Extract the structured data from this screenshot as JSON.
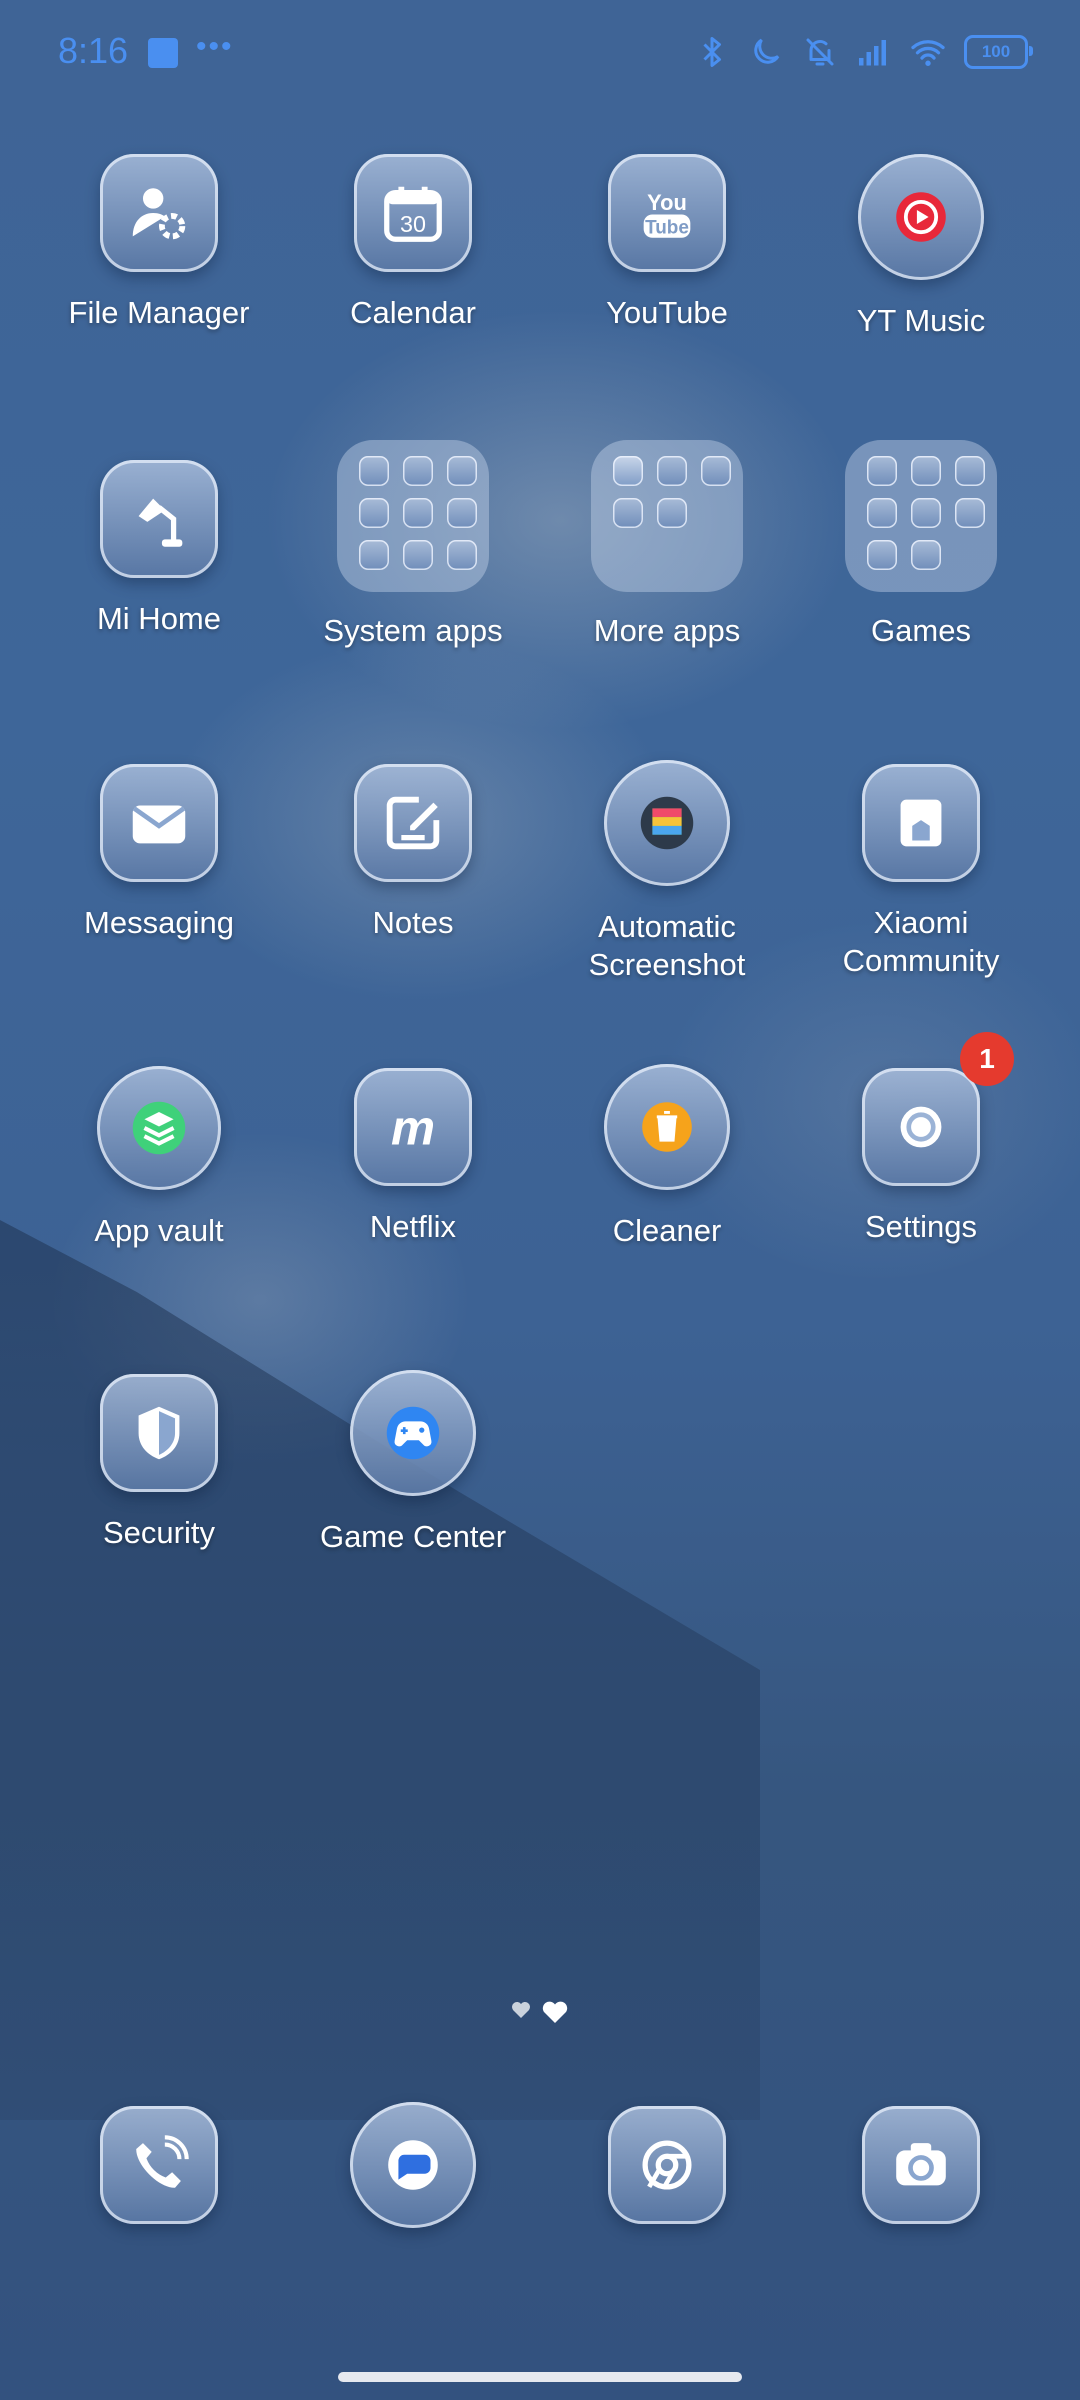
{
  "status_bar": {
    "time": "8:16",
    "battery": "100",
    "accent_color": "#4a8ff0",
    "icons": [
      "stop-square-icon",
      "more-dots-icon",
      "bluetooth-icon",
      "moon-icon",
      "bell-off-icon",
      "signal-icon",
      "wifi-icon",
      "battery-icon"
    ]
  },
  "apps": {
    "file_manager": "File Manager",
    "calendar": "Calendar",
    "calendar_day": "30",
    "youtube": "YouTube",
    "yt_music": "YT Music",
    "mi_home": "Mi Home",
    "system_apps": "System apps",
    "more_apps": "More apps",
    "games": "Games",
    "messaging": "Messaging",
    "notes": "Notes",
    "automatic_screenshot": [
      "Automatic",
      "Screenshot"
    ],
    "xiaomi_community": [
      "Xiaomi",
      "Community"
    ],
    "app_vault": "App vault",
    "netflix": "Netflix",
    "cleaner": "Cleaner",
    "settings": "Settings",
    "settings_badge": "1",
    "security": "Security",
    "game_center": "Game Center"
  },
  "dock": {
    "items": [
      "phone-icon",
      "messages-icon",
      "chrome-icon",
      "camera-icon"
    ]
  },
  "page_indicator": {
    "pages": 2,
    "current": 2
  },
  "colors": {
    "badge": "#e53a2e",
    "yt_music": "#e8283a",
    "cleaner": "#f6a31b",
    "app_vault": "#3fd17a"
  }
}
